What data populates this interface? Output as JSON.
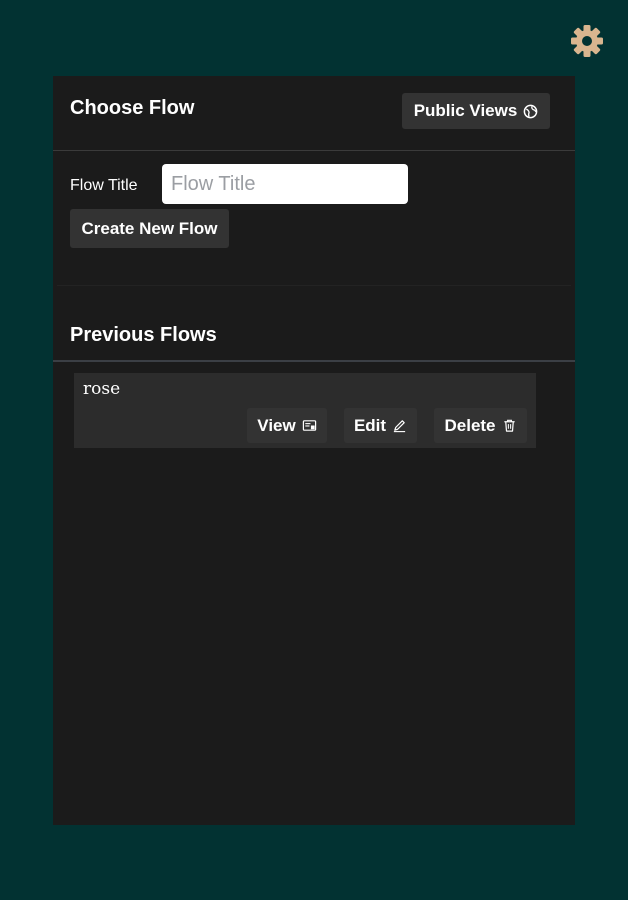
{
  "settings": {
    "icon": "gear-icon",
    "color": "#d9b58f"
  },
  "header": {
    "title": "Choose Flow",
    "public_views_label": "Public Views",
    "public_views_icon": "globe-icon"
  },
  "create": {
    "field_label": "Flow Title",
    "input_placeholder": "Flow Title",
    "input_value": "",
    "create_button_label": "Create New Flow"
  },
  "previous": {
    "title": "Previous Flows",
    "items": [
      {
        "name": "rose",
        "view_label": "View",
        "edit_label": "Edit",
        "delete_label": "Delete"
      }
    ]
  },
  "colors": {
    "background": "#023232",
    "panel": "#1b1b1b",
    "button": "#333333",
    "item": "#2c2c2c"
  }
}
